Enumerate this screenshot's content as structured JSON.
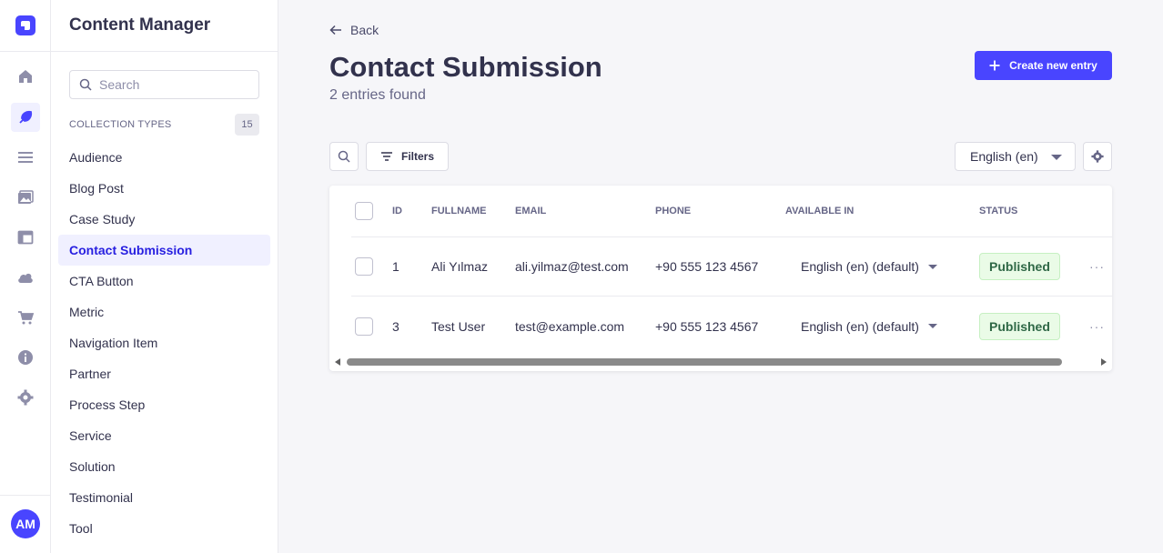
{
  "rail": {
    "items": [
      {
        "name": "home-icon",
        "active": false
      },
      {
        "name": "content-manager-icon",
        "active": true
      },
      {
        "name": "list-icon",
        "active": false
      },
      {
        "name": "media-library-icon",
        "active": false
      },
      {
        "name": "layout-icon",
        "active": false
      },
      {
        "name": "cloud-icon",
        "active": false
      },
      {
        "name": "cart-icon",
        "active": false
      },
      {
        "name": "info-icon",
        "active": false
      },
      {
        "name": "gear-icon",
        "active": false
      }
    ],
    "avatar_initials": "AM"
  },
  "subnav": {
    "title": "Content Manager",
    "search_placeholder": "Search",
    "section_label": "COLLECTION TYPES",
    "section_count": "15",
    "items": [
      {
        "label": "Audience",
        "active": false
      },
      {
        "label": "Blog Post",
        "active": false
      },
      {
        "label": "Case Study",
        "active": false
      },
      {
        "label": "Contact Submission",
        "active": true
      },
      {
        "label": "CTA Button",
        "active": false
      },
      {
        "label": "Metric",
        "active": false
      },
      {
        "label": "Navigation Item",
        "active": false
      },
      {
        "label": "Partner",
        "active": false
      },
      {
        "label": "Process Step",
        "active": false
      },
      {
        "label": "Service",
        "active": false
      },
      {
        "label": "Solution",
        "active": false
      },
      {
        "label": "Testimonial",
        "active": false
      },
      {
        "label": "Tool",
        "active": false
      }
    ]
  },
  "header": {
    "back_label": "Back",
    "title": "Contact Submission",
    "subtitle": "2 entries found",
    "create_label": "Create new entry"
  },
  "toolbar": {
    "filters_label": "Filters",
    "locale_value": "English (en)"
  },
  "table": {
    "columns": [
      "ID",
      "FULLNAME",
      "EMAIL",
      "PHONE",
      "AVAILABLE IN",
      "STATUS"
    ],
    "rows": [
      {
        "id": "1",
        "fullname": "Ali Yılmaz",
        "email": "ali.yilmaz@test.com",
        "phone": "+90 555 123 4567",
        "available_in": "English (en) (default)",
        "status": "Published",
        "more": "···"
      },
      {
        "id": "3",
        "fullname": "Test User",
        "email": "test@example.com",
        "phone": "+90 555 123 4567",
        "available_in": "English (en) (default)",
        "status": "Published",
        "more": "···"
      }
    ]
  },
  "colors": {
    "primary": "#4945ff",
    "active_text": "#271fe0",
    "published_bg": "#eafbe7",
    "published_text": "#2f6846"
  }
}
